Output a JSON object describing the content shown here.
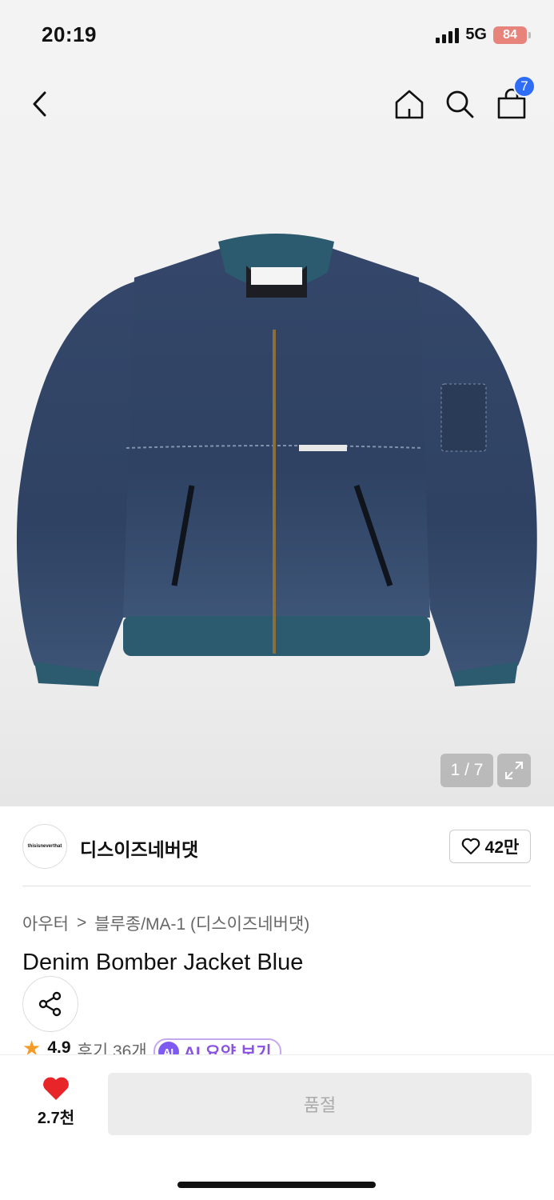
{
  "status_bar": {
    "time": "20:19",
    "network": "5G",
    "battery": "84"
  },
  "nav": {
    "back_icon": "chevron-left-icon",
    "home_icon": "home-icon",
    "search_icon": "search-icon",
    "cart_icon": "shopping-bag-icon",
    "cart_count": "7"
  },
  "gallery": {
    "counter": "1 / 7",
    "expand_icon": "expand-icon"
  },
  "brand": {
    "logo_text": "thisisneverthat",
    "name": "디스이즈네버댓",
    "like_count": "42만"
  },
  "breadcrumb": {
    "category": "아우터",
    "separator": ">",
    "subcategory": "블루종/MA-1 (디스이즈네버댓)"
  },
  "product": {
    "title": "Denim Bomber Jacket Blue"
  },
  "rating": {
    "score": "4.9",
    "reviews": "후기 36개",
    "ai_badge": "AI",
    "ai_label": "AI 요약 보기"
  },
  "bottom": {
    "wish_count": "2.7천",
    "buy_label": "품절"
  },
  "colors": {
    "accent": "#2f6df6",
    "heart": "#e8262a",
    "ai": "#7f5af0",
    "denim": "#2e3f5e"
  }
}
